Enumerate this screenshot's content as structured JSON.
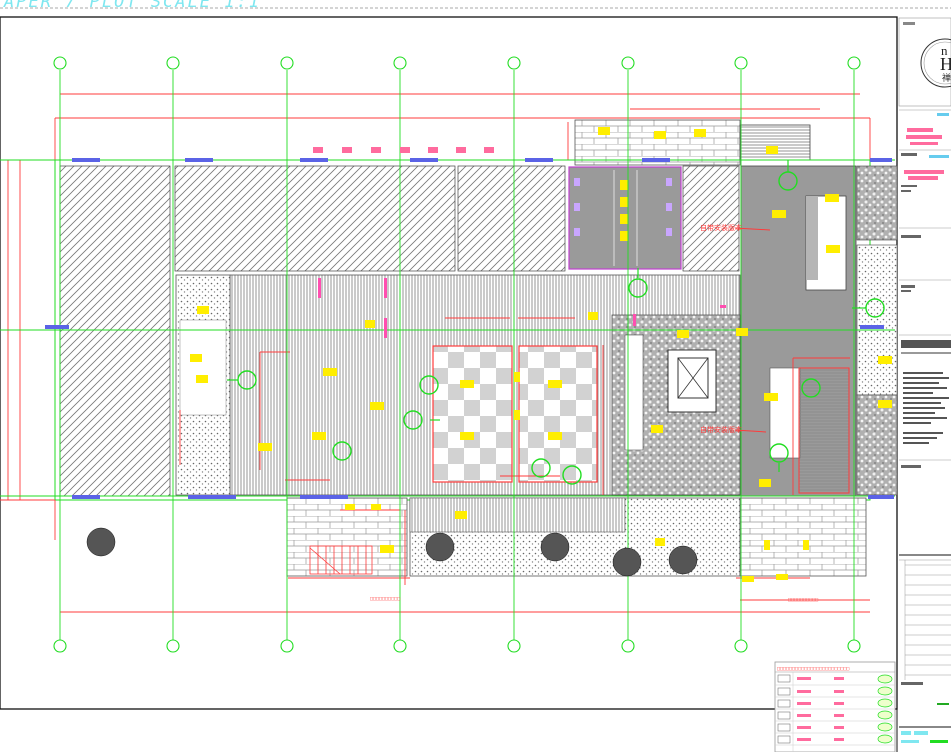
{
  "sheet": {
    "header_text": "APER 7 PLOT SCALE 1:1",
    "logo": {
      "line1": "n",
      "line2": "H",
      "line3": "禅"
    }
  },
  "annotations": {
    "arrow_label_1": "自带安装版本",
    "arrow_label_2": "自带安装版本",
    "section_label": "□□□□□□□□□□",
    "bottom_dim_label": "□□□□□□□□□□"
  },
  "legend": {
    "title": "□□□□□□□□□□□□□□□□□□□□□□□□"
  },
  "colors": {
    "grid_line": "#22dd22",
    "wall": "#ff3b3b",
    "hatch": "#777777",
    "fill_gray": "#9a9a9a",
    "accent_yellow": "#ffee00",
    "accent_magenta": "#ff4fb0",
    "accent_blue": "#5b63e6",
    "cyan_text": "#7fe7f0"
  },
  "icons": [
    "tree-symbol",
    "column-tag-circle",
    "stair-symbol",
    "elevator-symbol"
  ]
}
